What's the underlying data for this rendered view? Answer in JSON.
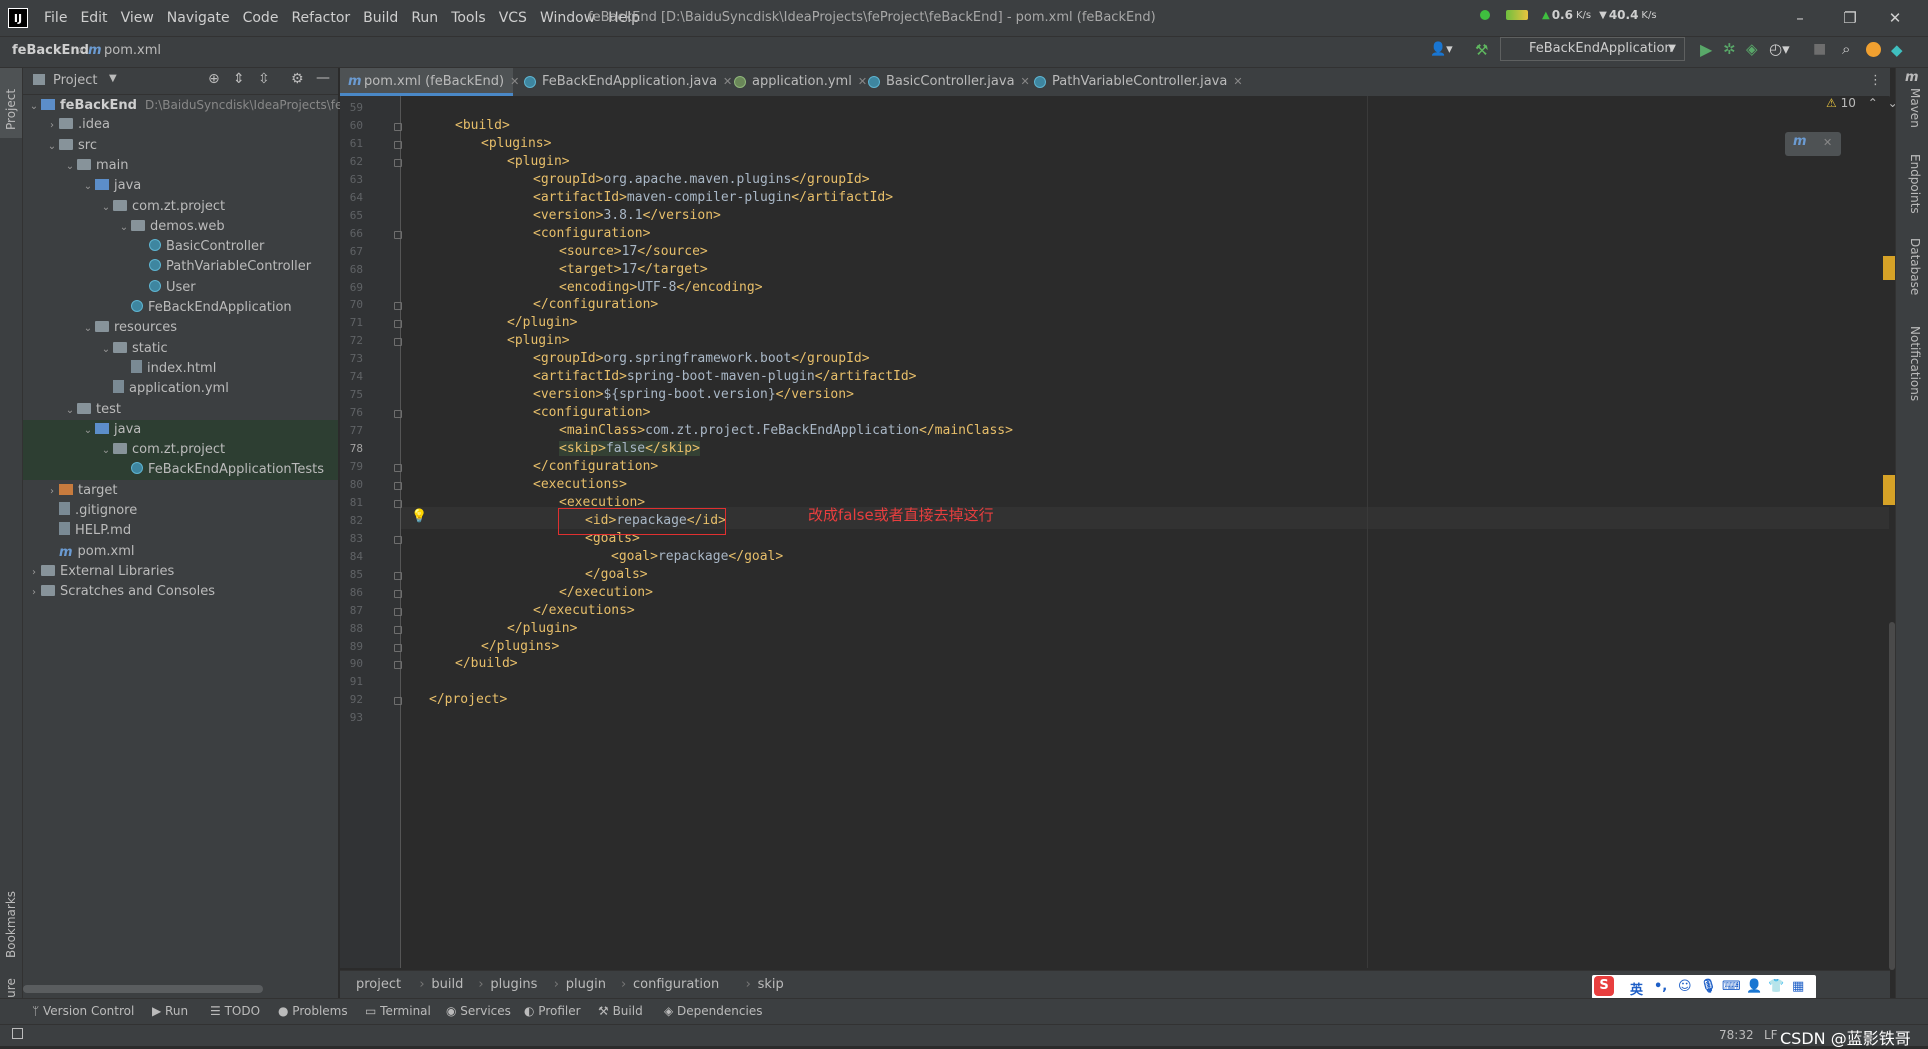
{
  "window": {
    "title": "feBackEnd [D:\\BaiduSyncdisk\\IdeaProjects\\feProject\\feBackEnd] - pom.xml (feBackEnd)",
    "logo": "IJ",
    "net_up": "0.6",
    "net_down": "40.4",
    "net_unit": "K/s"
  },
  "menu": [
    "File",
    "Edit",
    "View",
    "Navigate",
    "Code",
    "Refactor",
    "Build",
    "Run",
    "Tools",
    "VCS",
    "Window",
    "Help"
  ],
  "nav": {
    "project": "feBackEnd",
    "file": "pom.xml",
    "run_config": "FeBackEndApplication",
    "m_glyph": "m"
  },
  "left_strip": {
    "project": "Project",
    "bookmarks": "Bookmarks",
    "structure": "Structure"
  },
  "project_panel": {
    "title": "Project",
    "tree": [
      {
        "label": "feBackEnd",
        "path": "D:\\BaiduSyncdisk\\IdeaProjects\\fePr"
      },
      {
        "label": ".idea"
      },
      {
        "label": "src"
      },
      {
        "label": "main"
      },
      {
        "label": "java"
      },
      {
        "label": "com.zt.project"
      },
      {
        "label": "demos.web"
      },
      {
        "label": "BasicController"
      },
      {
        "label": "PathVariableController"
      },
      {
        "label": "User"
      },
      {
        "label": "FeBackEndApplication"
      },
      {
        "label": "resources"
      },
      {
        "label": "static"
      },
      {
        "label": "index.html"
      },
      {
        "label": "application.yml"
      },
      {
        "label": "test"
      },
      {
        "label": "java"
      },
      {
        "label": "com.zt.project"
      },
      {
        "label": "FeBackEndApplicationTests"
      },
      {
        "label": "target"
      },
      {
        "label": ".gitignore"
      },
      {
        "label": "HELP.md"
      },
      {
        "label": "pom.xml"
      },
      {
        "label": "External Libraries"
      },
      {
        "label": "Scratches and Consoles"
      }
    ]
  },
  "tabs": [
    {
      "label": "pom.xml (feBackEnd)"
    },
    {
      "label": "FeBackEndApplication.java"
    },
    {
      "label": "application.yml"
    },
    {
      "label": "BasicController.java"
    },
    {
      "label": "PathVariableController.java"
    }
  ],
  "editor": {
    "warnings": "10",
    "lines": [
      {
        "n": "59",
        "i": 0,
        "t": ""
      },
      {
        "n": "60",
        "i": 1,
        "t": "<build>"
      },
      {
        "n": "61",
        "i": 2,
        "t": "<plugins>"
      },
      {
        "n": "62",
        "i": 3,
        "t": "<plugin>"
      },
      {
        "n": "63",
        "i": 4,
        "t": "<groupId>org.apache.maven.plugins</groupId>"
      },
      {
        "n": "64",
        "i": 4,
        "t": "<artifactId>maven-compiler-plugin</artifactId>"
      },
      {
        "n": "65",
        "i": 4,
        "t": "<version>3.8.1</version>"
      },
      {
        "n": "66",
        "i": 4,
        "t": "<configuration>"
      },
      {
        "n": "67",
        "i": 5,
        "t": "<source>17</source>"
      },
      {
        "n": "68",
        "i": 5,
        "t": "<target>17</target>"
      },
      {
        "n": "69",
        "i": 5,
        "t": "<encoding>UTF-8</encoding>"
      },
      {
        "n": "70",
        "i": 4,
        "t": "</configuration>"
      },
      {
        "n": "71",
        "i": 3,
        "t": "</plugin>"
      },
      {
        "n": "72",
        "i": 3,
        "t": "<plugin>"
      },
      {
        "n": "73",
        "i": 4,
        "t": "<groupId>org.springframework.boot</groupId>"
      },
      {
        "n": "74",
        "i": 4,
        "t": "<artifactId>spring-boot-maven-plugin</artifactId>"
      },
      {
        "n": "75",
        "i": 4,
        "t": "<version>${spring-boot.version}</version>"
      },
      {
        "n": "76",
        "i": 4,
        "t": "<configuration>"
      },
      {
        "n": "77",
        "i": 5,
        "t": "<mainClass>com.zt.project.FeBackEndApplication</mainClass>"
      },
      {
        "n": "78",
        "i": 5,
        "t": "<skip>false</skip>"
      },
      {
        "n": "79",
        "i": 4,
        "t": "</configuration>"
      },
      {
        "n": "80",
        "i": 4,
        "t": "<executions>"
      },
      {
        "n": "81",
        "i": 5,
        "t": "<execution>"
      },
      {
        "n": "82",
        "i": 6,
        "t": "<id>repackage</id>"
      },
      {
        "n": "83",
        "i": 6,
        "t": "<goals>"
      },
      {
        "n": "84",
        "i": 7,
        "t": "<goal>repackage</goal>"
      },
      {
        "n": "85",
        "i": 6,
        "t": "</goals>"
      },
      {
        "n": "86",
        "i": 5,
        "t": "</execution>"
      },
      {
        "n": "87",
        "i": 4,
        "t": "</executions>"
      },
      {
        "n": "88",
        "i": 3,
        "t": "</plugin>"
      },
      {
        "n": "89",
        "i": 2,
        "t": "</plugins>"
      },
      {
        "n": "90",
        "i": 1,
        "t": "</build>"
      },
      {
        "n": "91",
        "i": 0,
        "t": ""
      },
      {
        "n": "92",
        "i": 0,
        "t": "</project>"
      },
      {
        "n": "93",
        "i": 0,
        "t": ""
      }
    ],
    "annotation": "改成false或者直接去掉这行"
  },
  "right_strip": {
    "maven": "Maven",
    "endpoints": "Endpoints",
    "database": "Database",
    "notifications": "Notifications"
  },
  "breadcrumb": [
    "project",
    "build",
    "plugins",
    "plugin",
    "configuration",
    "skip"
  ],
  "tool_windows": [
    "Version Control",
    "Run",
    "TODO",
    "Problems",
    "Terminal",
    "Services",
    "Profiler",
    "Build",
    "Dependencies"
  ],
  "status": {
    "position": "78:32",
    "line_sep": "LF",
    "watermark": "CSDN @蓝影铁哥"
  },
  "ime": {
    "logo": "S",
    "lang": "英"
  },
  "colors": {
    "tag": "#e8bf6a",
    "text": "#a9b7c6",
    "accent": "#4a88c7",
    "annotation": "#e83e3e"
  }
}
